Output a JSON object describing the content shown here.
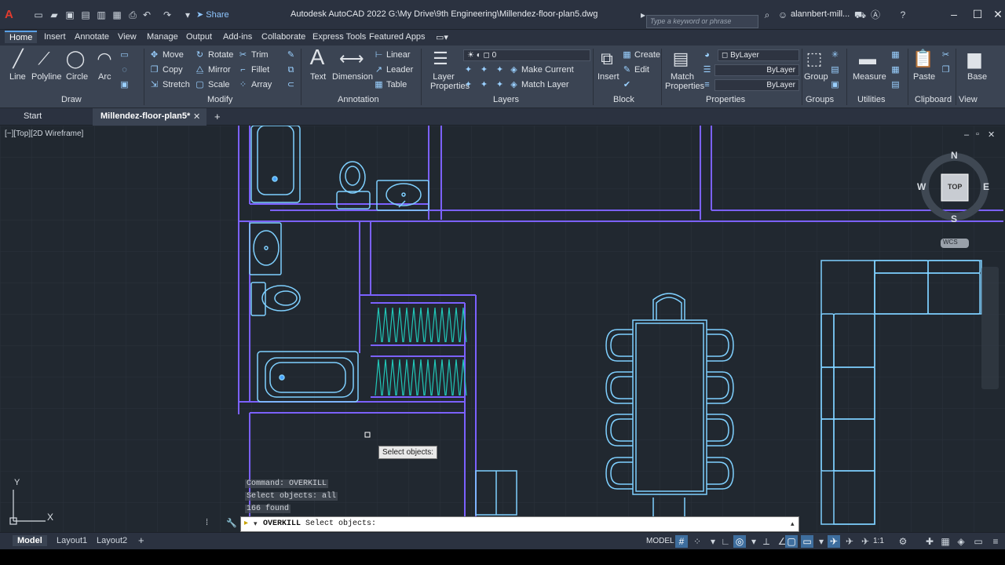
{
  "titlebar": {
    "logo": "A",
    "share_label": "Share",
    "app_title": "Autodesk AutoCAD 2022   G:\\My Drive\\9th Engineering\\Millendez-floor-plan5.dwg",
    "search_placeholder": "Type a keyword or phrase",
    "user_name": "alannbert-mill..."
  },
  "ribbon_tabs": [
    "Home",
    "Insert",
    "Annotate",
    "View",
    "Manage",
    "Output",
    "Add-ins",
    "Collaborate",
    "Express Tools",
    "Featured Apps"
  ],
  "ribbon": {
    "draw": {
      "label": "Draw",
      "tools": [
        "Line",
        "Polyline",
        "Circle",
        "Arc"
      ]
    },
    "modify": {
      "label": "Modify",
      "tools": [
        "Move",
        "Rotate",
        "Trim",
        "Copy",
        "Mirror",
        "Fillet",
        "Stretch",
        "Scale",
        "Array"
      ]
    },
    "annotation": {
      "label": "Annotation",
      "tools": [
        "Text",
        "Dimension"
      ],
      "small": [
        "Linear",
        "Leader",
        "Table"
      ]
    },
    "layers": {
      "label": "Layers",
      "big_tool": "Layer Properties",
      "current_layer": "0",
      "tools": [
        "Make Current",
        "Match Layer"
      ]
    },
    "block": {
      "label": "Block",
      "big_tool": "Insert",
      "tools": [
        "Create",
        "Edit"
      ]
    },
    "properties": {
      "label": "Properties",
      "big_tool": "Match Properties",
      "color": "ByLayer",
      "linetype": "ByLayer",
      "lineweight": "ByLayer"
    },
    "groups": {
      "label": "Groups",
      "big_tool": "Group"
    },
    "utilities": {
      "label": "Utilities",
      "big_tool": "Measure"
    },
    "clipboard": {
      "label": "Clipboard",
      "big_tool": "Paste"
    },
    "view": {
      "label": "View",
      "big_tool": "Base"
    }
  },
  "doc_tabs": {
    "start": "Start",
    "active": "Millendez-floor-plan5*"
  },
  "viewport": {
    "label": "[−][Top][2D Wireframe]",
    "viewcube": {
      "n": "N",
      "s": "S",
      "e": "E",
      "w": "W",
      "face": "TOP",
      "wcs": "WCS"
    },
    "ucs": {
      "x": "X",
      "y": "Y"
    }
  },
  "command": {
    "history": [
      "Command: OVERKILL",
      "Select objects: all",
      "166 found"
    ],
    "prompt_cmd": "OVERKILL",
    "prompt_text": "Select objects:",
    "tooltip": "Select objects:"
  },
  "statusbar": {
    "layouts": [
      "Model",
      "Layout1",
      "Layout2"
    ],
    "model_label": "MODEL",
    "scale": "1:1"
  },
  "colors": {
    "wall": "#7b61ff",
    "fixture": "#7fd0ff",
    "hatch": "#21c7b8",
    "bg": "#212830"
  }
}
